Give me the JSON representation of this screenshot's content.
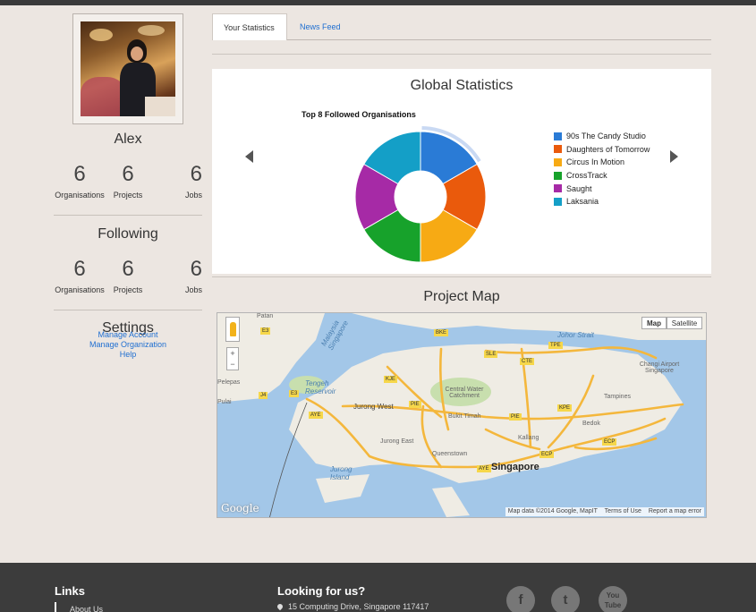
{
  "profile": {
    "name": "Alex",
    "stats": [
      {
        "value": "6",
        "label": "Organisations"
      },
      {
        "value": "6",
        "label": "Projects"
      },
      {
        "value": "6",
        "label": "Jobs"
      }
    ]
  },
  "following": {
    "title": "Following",
    "stats": [
      {
        "value": "6",
        "label": "Organisations"
      },
      {
        "value": "6",
        "label": "Projects"
      },
      {
        "value": "6",
        "label": "Jobs"
      }
    ]
  },
  "settings": {
    "title": "Settings",
    "links": [
      "Manage Account",
      "Manage Organization",
      "Help"
    ]
  },
  "tabs": [
    {
      "label": "Your Statistics",
      "active": true
    },
    {
      "label": "News Feed",
      "active": false
    }
  ],
  "stats_card": {
    "title": "Global Statistics"
  },
  "chart_data": {
    "type": "pie",
    "title": "Top 8 Followed Organisations",
    "donut": true,
    "slices": [
      {
        "name": "90s The Candy Studio",
        "value": 1,
        "color": "#2a7bd6"
      },
      {
        "name": "Daughters of Tomorrow",
        "value": 1,
        "color": "#ea5a0c"
      },
      {
        "name": "Circus In Motion",
        "value": 1,
        "color": "#f7aa14"
      },
      {
        "name": "CrossTrack",
        "value": 1,
        "color": "#17a22b"
      },
      {
        "name": "Saught",
        "value": 1,
        "color": "#a62aa6"
      },
      {
        "name": "Laksania",
        "value": 1,
        "color": "#149fc7"
      }
    ],
    "legend_position": "right"
  },
  "map_section": {
    "title": "Project Map",
    "type_buttons": {
      "map": "Map",
      "satellite": "Satellite"
    },
    "zoom": {
      "in": "+",
      "out": "−"
    },
    "labels": {
      "singapore": "Singapore",
      "jurong_west": "Jurong West",
      "jurong_east": "Jurong East",
      "bukit_timah": "Bukit Timah",
      "queenstown": "Queenstown",
      "kallang": "Kallang",
      "bedok": "Bedok",
      "tampines": "Tampines",
      "changi": "Changi Airport Singapore",
      "central_water": "Central Water Catchment",
      "tengeh": "Tengeh Reservoir",
      "jurong_island": "Jurong Island",
      "johor_strait": "Johor Strait",
      "patan": "Patan",
      "pelepas": "Pelepas",
      "pulai": "Pulai",
      "malaysia_singapore": "Malaysia Singapore"
    },
    "road_labels": [
      "E3",
      "E3",
      "J4",
      "KJE",
      "PIE",
      "AYE",
      "BKE",
      "SLE",
      "TPE",
      "CTE",
      "PIE",
      "KPE",
      "ECP",
      "ECP",
      "AYE"
    ],
    "attribution": {
      "data": "Map data ©2014 Google, MapIT",
      "terms": "Terms of Use",
      "report": "Report a map error"
    },
    "logo": "Google",
    "colors": {
      "water": "#a3c7e8",
      "land": "#efece4",
      "expressway": "#f4b73c"
    }
  },
  "footer": {
    "links_title": "Links",
    "link_item": "About Us",
    "find_title": "Looking for us?",
    "address": "15 Computing Drive, Singapore 117417",
    "social": [
      {
        "name": "facebook",
        "glyph": "f"
      },
      {
        "name": "twitter",
        "glyph": "t"
      },
      {
        "name": "youtube",
        "glyph": "You Tube"
      }
    ]
  }
}
